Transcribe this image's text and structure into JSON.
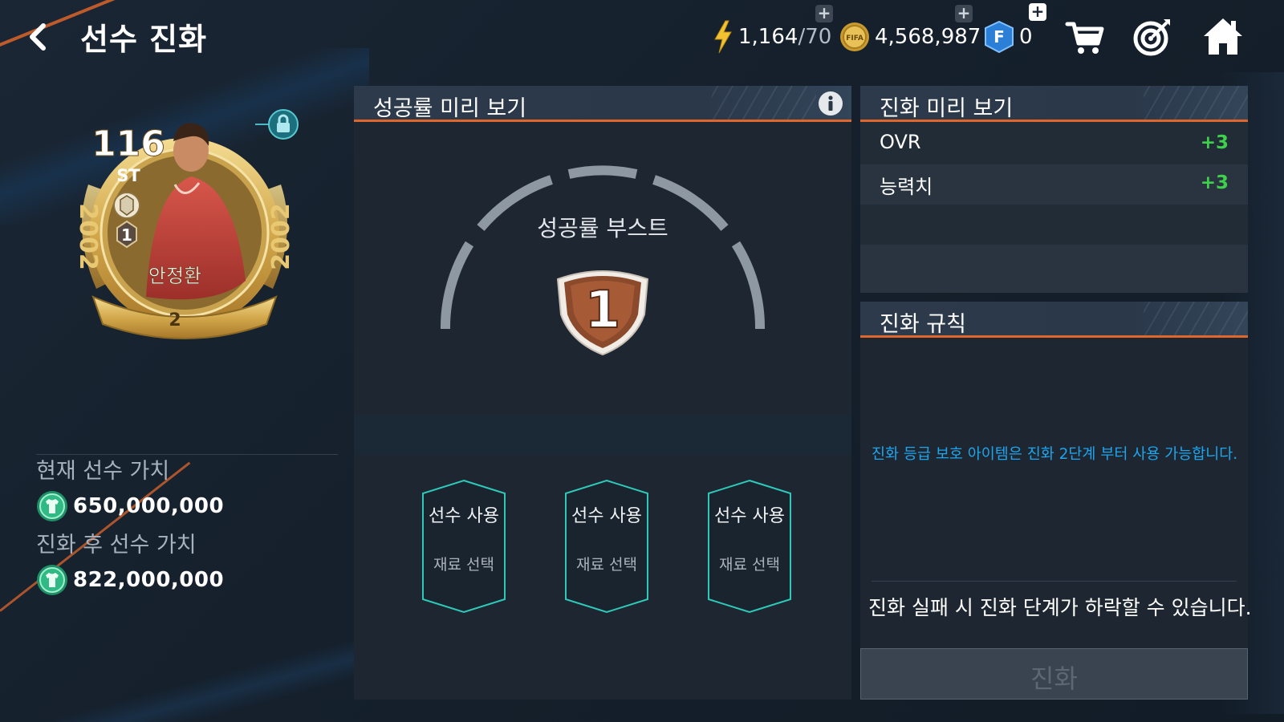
{
  "header": {
    "title": "선수 진화",
    "energy": {
      "current": "1,164",
      "max": "/70",
      "icon": "lightning-icon"
    },
    "coins": {
      "value": "4,568,987",
      "icon": "fifa-coin-icon"
    },
    "fifa_points": {
      "value": "0",
      "icon": "fp-icon",
      "letter": "F"
    },
    "add_symbol": "+",
    "icons": [
      "back-icon",
      "cart-icon",
      "target-icon",
      "home-icon"
    ]
  },
  "player": {
    "rating": "116",
    "position": "ST",
    "name": "안정환",
    "year": "2002",
    "rank_badge": "1",
    "bottom_badge": "2"
  },
  "values": {
    "current_label": "현재 선수 가치",
    "current_value": "650,000,000",
    "after_label": "진화 후 선수 가치",
    "after_value": "822,000,000"
  },
  "success_preview": {
    "title": "성공률 미리 보기",
    "boost_label": "성공률 부스트",
    "boost_level": "1",
    "slots": [
      {
        "label": "선수 사용",
        "sub": "재료 선택"
      },
      {
        "label": "선수 사용",
        "sub": "재료 선택"
      },
      {
        "label": "선수 사용",
        "sub": "재료 선택"
      }
    ]
  },
  "evolution_preview": {
    "title": "진화 미리 보기",
    "stats": [
      {
        "name": "OVR",
        "delta": "+3"
      },
      {
        "name": "능력치",
        "delta": "+3"
      }
    ]
  },
  "rules": {
    "title": "진화 규칙",
    "info": "진화 등급 보호 아이템은 진화 2단계 부터 사용 가능합니다.",
    "warning": "진화 실패 시 진화 단계가 하락할 수 있습니다.",
    "button": "진화"
  },
  "colors": {
    "accent_orange": "#e0672b",
    "stat_green": "#3fd14c",
    "info_blue": "#1ea5ee",
    "slot_teal": "#2fc9b9",
    "card_gold": "#d9b45a"
  }
}
